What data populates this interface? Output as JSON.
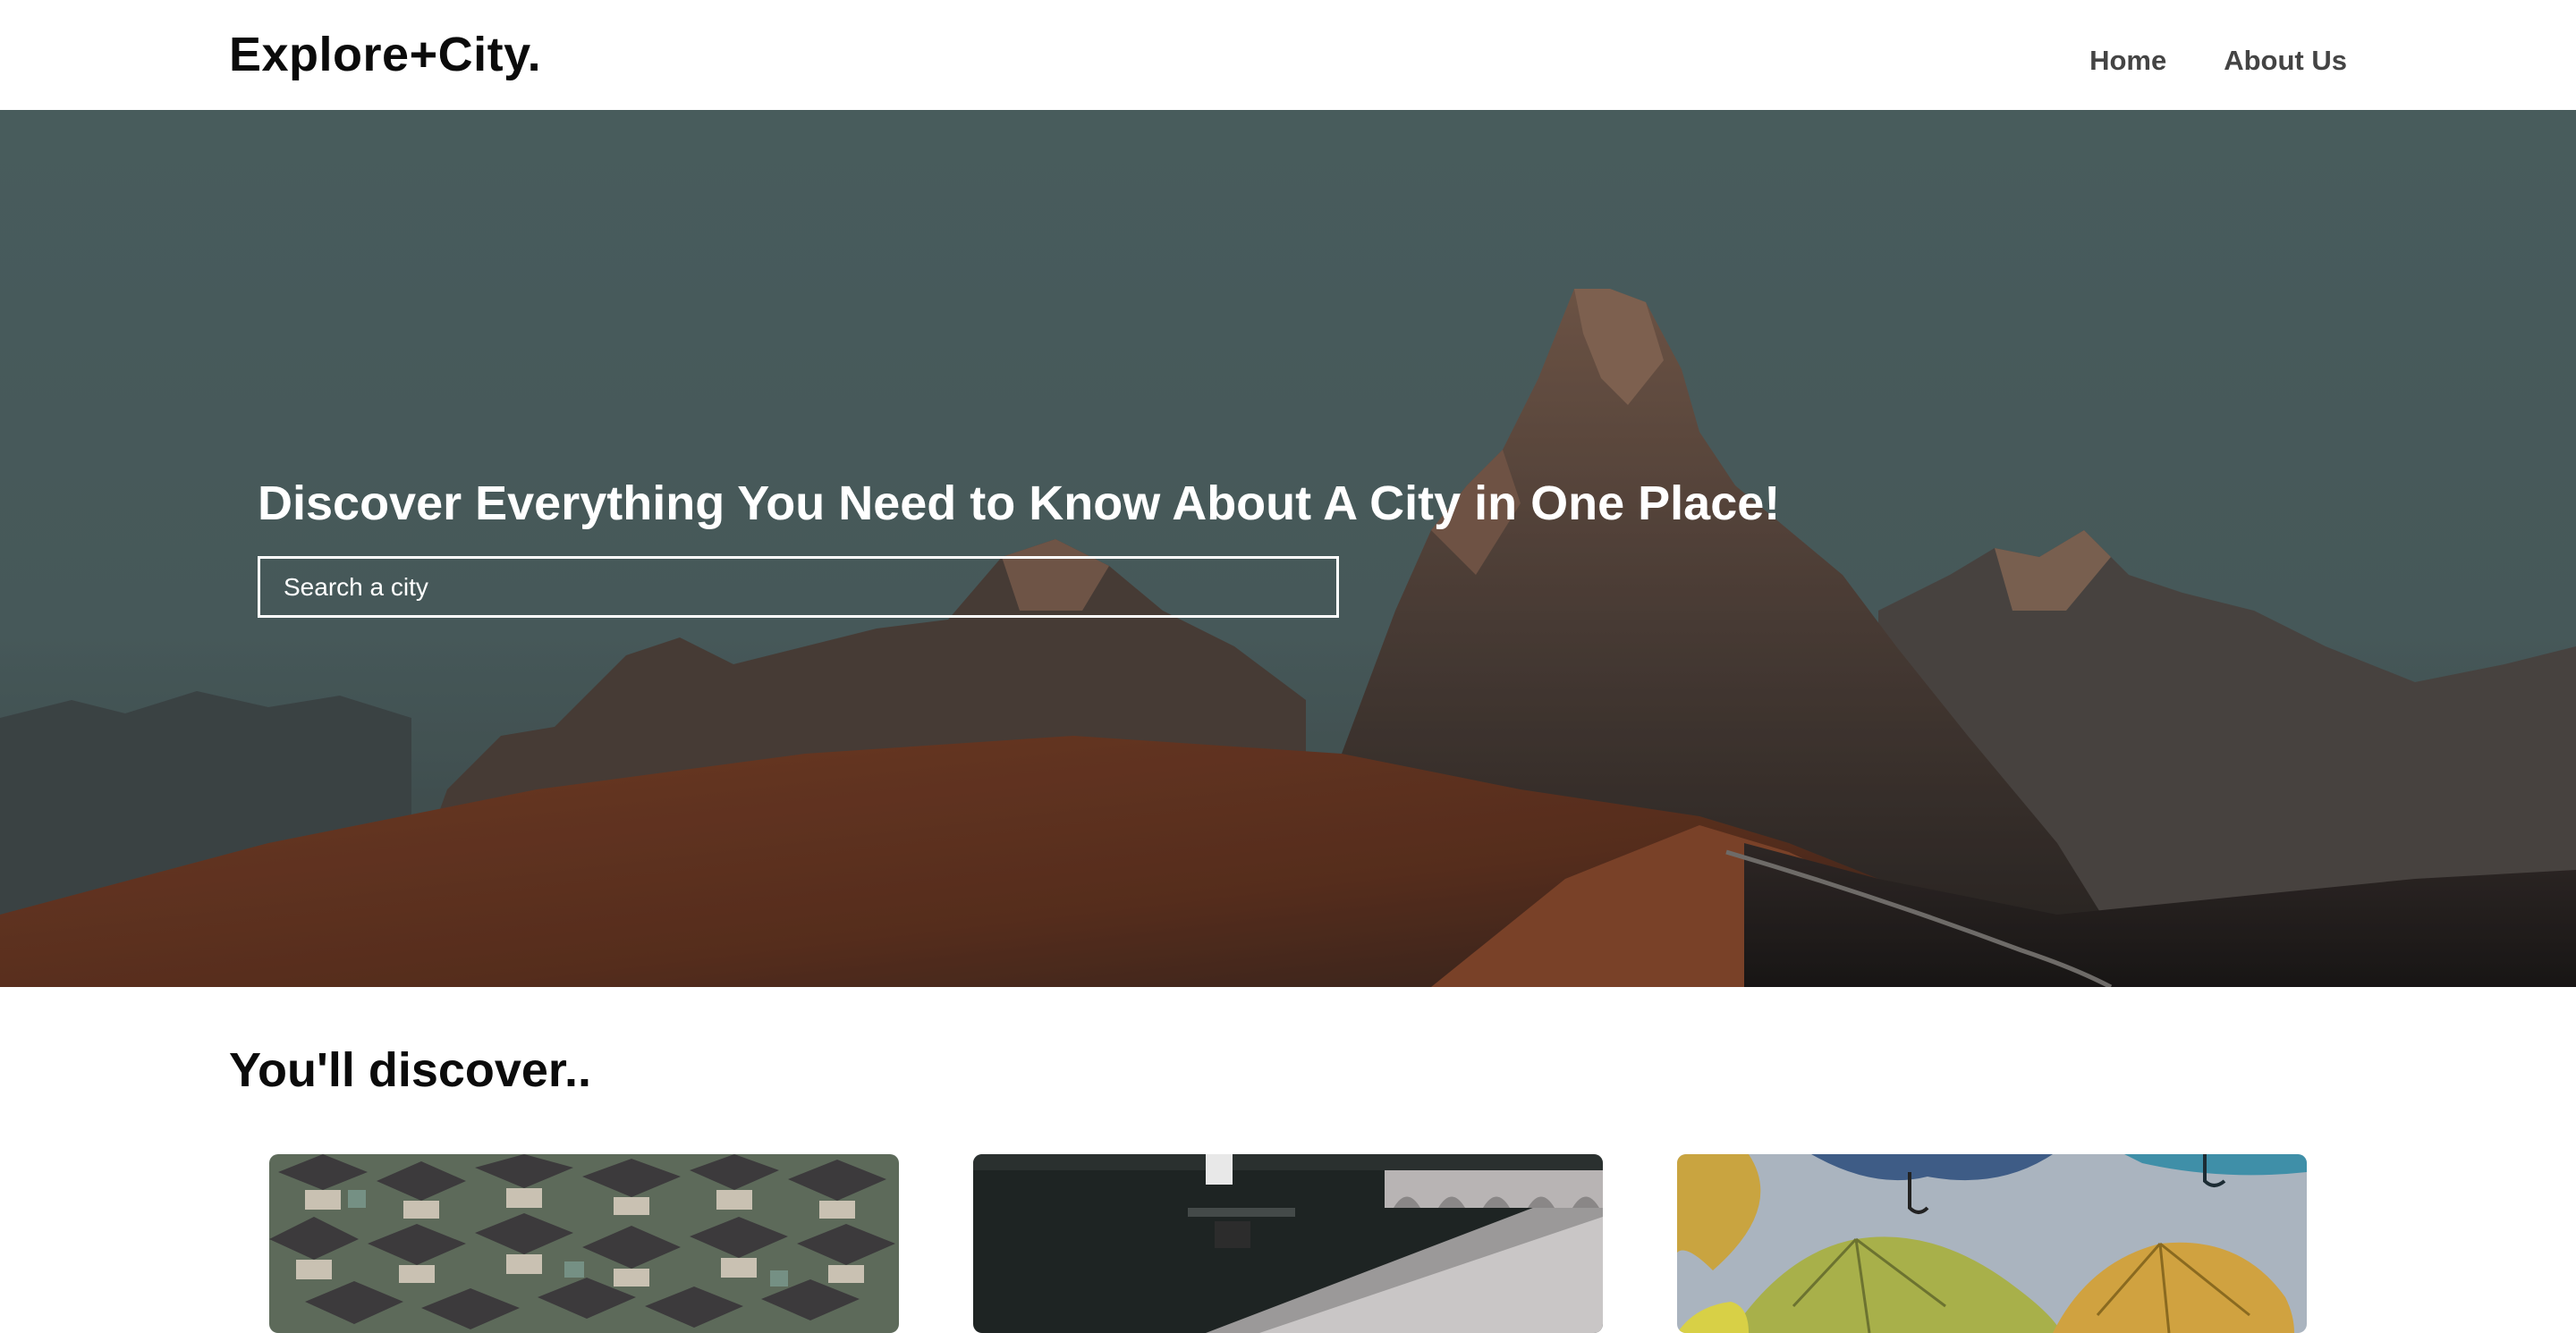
{
  "header": {
    "logo": "Explore+City.",
    "nav": [
      {
        "label": "Home"
      },
      {
        "label": "About Us"
      }
    ]
  },
  "hero": {
    "title": "Discover Everything You Need to Know About A City in One Place!",
    "search": {
      "placeholder": "Search a city",
      "value": ""
    },
    "background_image": "mountain-landscape"
  },
  "discover": {
    "title": "You'll discover..",
    "cards": [
      {
        "image": "houses-aerial"
      },
      {
        "image": "train-station"
      },
      {
        "image": "colorful-umbrellas"
      }
    ]
  },
  "colors": {
    "text_dark": "#0b0b0b",
    "nav_text": "#444444",
    "hero_overlay_text": "#ffffff"
  }
}
